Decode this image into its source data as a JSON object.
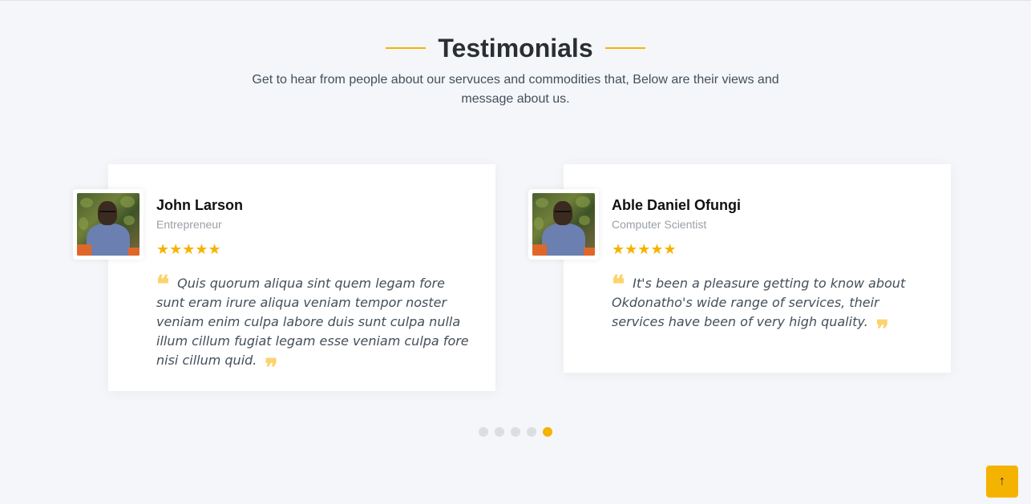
{
  "section": {
    "title": "Testimonials",
    "subtitle": "Get to hear from people about our servuces and commodities that, Below are their views and message about us."
  },
  "testimonials": [
    {
      "name": "John Larson",
      "role": "Entrepreneur",
      "rating": 5,
      "stars": "★★★★★",
      "quote": "Quis quorum aliqua sint quem legam fore sunt eram irure aliqua veniam tempor noster veniam enim culpa labore duis sunt culpa nulla illum cillum fugiat legam esse veniam culpa fore nisi cillum quid."
    },
    {
      "name": "Able Daniel Ofungi",
      "role": "Computer Scientist",
      "rating": 5,
      "stars": "★★★★★",
      "quote": "It's been a pleasure getting to know about Okdonatho's wide range of services, their services have been of very high quality."
    }
  ],
  "quote_marks": {
    "open": "❝",
    "close": "❞"
  },
  "pagination": {
    "count": 5,
    "active_index": 4
  },
  "back_to_top": {
    "icon": "arrow-up-icon",
    "glyph": "↑"
  },
  "colors": {
    "accent": "#f5b301",
    "background": "#f4f6f9",
    "quote_mark": "#fcd36b",
    "dot_inactive": "#dcdde0"
  }
}
